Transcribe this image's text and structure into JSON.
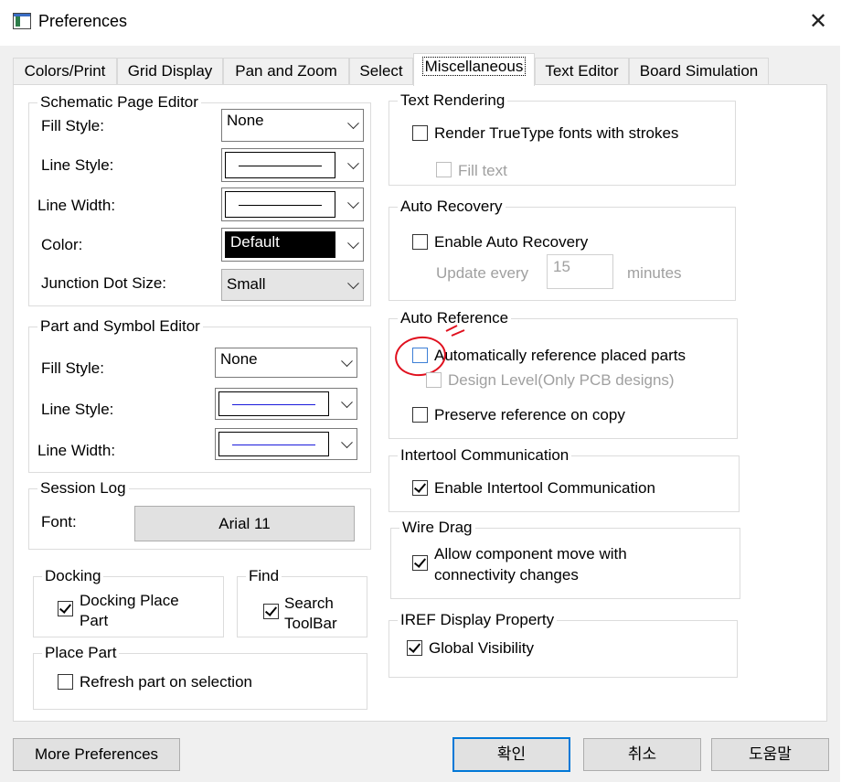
{
  "window": {
    "title": "Preferences"
  },
  "tabs": [
    {
      "label": "Colors/Print"
    },
    {
      "label": "Grid Display"
    },
    {
      "label": "Pan and Zoom"
    },
    {
      "label": "Select"
    },
    {
      "label": "Miscellaneous",
      "active": true
    },
    {
      "label": "Text Editor"
    },
    {
      "label": "Board Simulation"
    }
  ],
  "schematic": {
    "title": "Schematic Page Editor",
    "fill_style_label": "Fill Style:",
    "fill_style_value": "None",
    "line_style_label": "Line Style:",
    "line_width_label": "Line Width:",
    "color_label": "Color:",
    "color_value": "Default",
    "junction_label": "Junction Dot Size:",
    "junction_value": "Small"
  },
  "part_symbol": {
    "title": "Part and Symbol Editor",
    "fill_style_label": "Fill Style:",
    "fill_style_value": "None",
    "line_style_label": "Line Style:",
    "line_width_label": "Line Width:",
    "line_color": "#1a1adc"
  },
  "session_log": {
    "title": "Session Log",
    "font_label": "Font:",
    "font_button": "Arial 11"
  },
  "docking": {
    "title": "Docking",
    "checkbox_label_1": "Docking Place",
    "checkbox_label_2": "Part",
    "checked": true
  },
  "find": {
    "title": "Find",
    "checkbox_label_1": "Search",
    "checkbox_label_2": "ToolBar",
    "checked": true
  },
  "place_part": {
    "title": "Place Part",
    "checkbox_label": "Refresh part on selection",
    "checked": false
  },
  "text_rendering": {
    "title": "Text Rendering",
    "render_label": "Render TrueType fonts with strokes",
    "fill_text_label": "Fill text"
  },
  "auto_recovery": {
    "title": "Auto Recovery",
    "enable_label": "Enable Auto Recovery",
    "update_label": "Update every",
    "update_value": "15",
    "minutes_label": "minutes"
  },
  "auto_reference": {
    "title": "Auto Reference",
    "auto_label": "Automatically reference placed parts",
    "design_level_label": "Design Level(Only PCB designs)",
    "preserve_label": "Preserve reference on copy",
    "annotation_color": "#e0101e"
  },
  "intertool": {
    "title": "Intertool Communication",
    "enable_label": "Enable Intertool Communication",
    "checked": true
  },
  "wire_drag": {
    "title": "Wire Drag",
    "label_1": "Allow component move with",
    "label_2": "connectivity changes",
    "checked": true
  },
  "iref": {
    "title": "IREF Display Property",
    "label": "Global Visibility",
    "checked": true
  },
  "buttons": {
    "more_preferences": "More Preferences",
    "ok": "확인",
    "cancel": "취소",
    "help": "도움말"
  }
}
